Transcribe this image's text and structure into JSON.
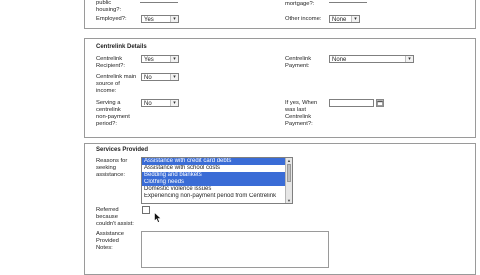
{
  "top": {
    "public_housing_label": "public\nhousing?:",
    "mortgage_label": "mortgage?:",
    "employed_label": "Employed?:",
    "employed_value": "Yes",
    "other_income_label": "Other income:",
    "other_income_value": "None"
  },
  "centrelink": {
    "title": "Centrelink Details",
    "recipient_label": "Centrelink\nRecipient?:",
    "recipient_value": "Yes",
    "payment_label": "Centrelink\nPayment:",
    "payment_value": "None",
    "main_source_label": "Centrelink main\nsource of\nincome:",
    "main_source_value": "No",
    "serving_label": "Serving a\ncentrelink\nnon-payment\nperiod?:",
    "serving_value": "No",
    "when_label": "If yes, When\nwas last\nCentrelink\nPayment?:",
    "when_value": ""
  },
  "services": {
    "title": "Services Provided",
    "reasons_label": "Reasons for\nseeking\nassistance:",
    "reasons": [
      {
        "label": "Assistance with credit card debts",
        "selected": true
      },
      {
        "label": "Assistance with school costs",
        "selected": false
      },
      {
        "label": "Bedding and blankets",
        "selected": true
      },
      {
        "label": "Clothing needs",
        "selected": true
      },
      {
        "label": "Domestic violence issues",
        "selected": false
      },
      {
        "label": "Experiencing non-payment period from Centrelink",
        "selected": false
      }
    ],
    "referred_label": "Referred\nbecause\ncouldn't assist:",
    "notes_label": "Assistance\nProvided\nNotes:",
    "notes_value": ""
  },
  "icons": {
    "calendar": "calendar-icon",
    "dropdown": "chevron-down-icon"
  }
}
